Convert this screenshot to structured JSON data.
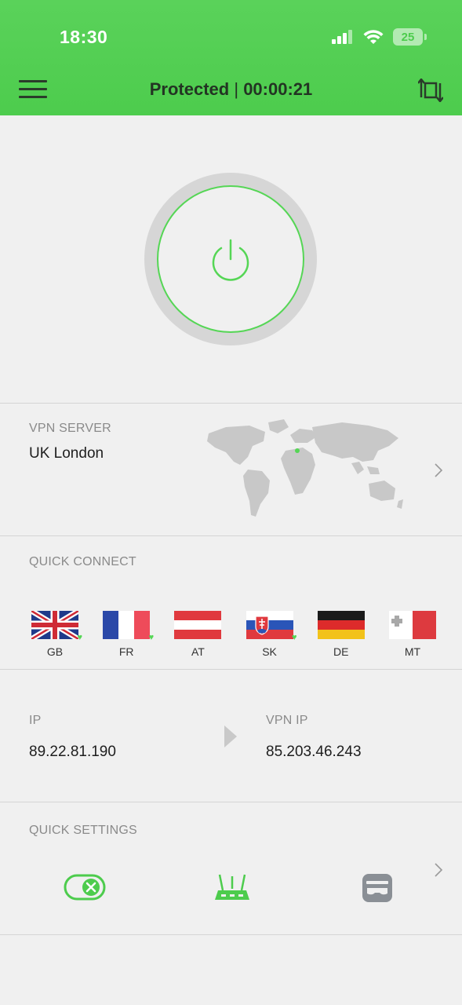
{
  "status_bar": {
    "time": "18:30",
    "battery": "25"
  },
  "header": {
    "status": "Protected",
    "separator": "|",
    "timer": "00:00:21"
  },
  "vpn_server": {
    "label": "VPN SERVER",
    "value": "UK London"
  },
  "quick_connect": {
    "label": "QUICK CONNECT",
    "flags": [
      {
        "code": "GB",
        "favorite": true
      },
      {
        "code": "FR",
        "favorite": true
      },
      {
        "code": "AT",
        "favorite": false
      },
      {
        "code": "SK",
        "favorite": true
      },
      {
        "code": "DE",
        "favorite": false
      },
      {
        "code": "MT",
        "favorite": false
      }
    ]
  },
  "ip": {
    "label": "IP",
    "value": "89.22.81.190"
  },
  "vpn_ip": {
    "label": "VPN IP",
    "value": "85.203.46.243"
  },
  "quick_settings": {
    "label": "QUICK SETTINGS"
  },
  "colors": {
    "accent": "#4dcc4d",
    "background": "#f0f0f0",
    "text": "#1e1e1e",
    "muted": "#8a8a8a"
  }
}
